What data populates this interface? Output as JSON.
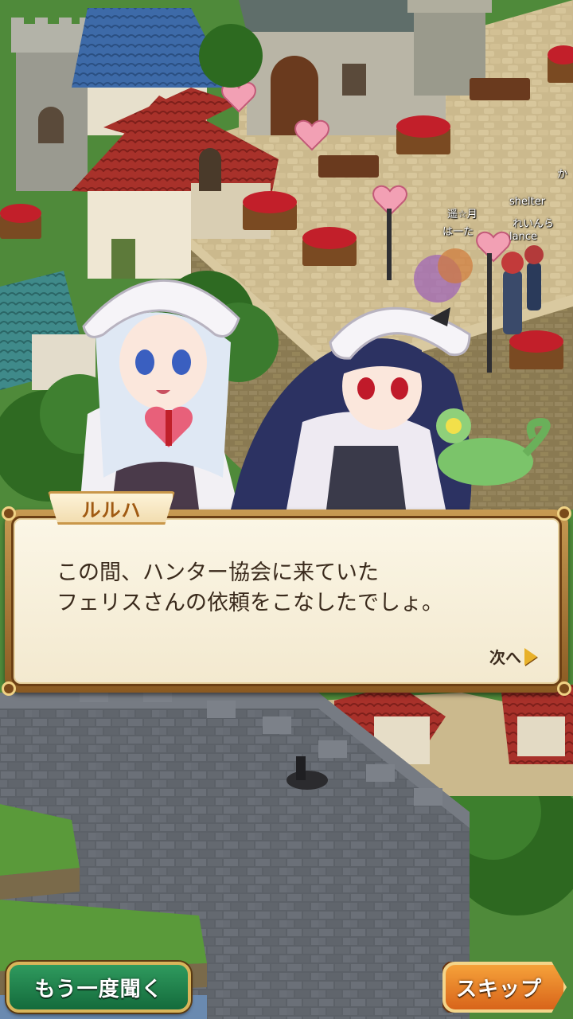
{
  "dialog": {
    "speaker": "ルルハ",
    "text": "この間、ハンター協会に来ていた\nフェリスさんの依頼をこなしたでしょ。",
    "next_label": "次へ"
  },
  "players": [
    {
      "name": "shelter"
    },
    {
      "name": "遥☆月"
    },
    {
      "name": "れいんら"
    },
    {
      "name": "は一た"
    },
    {
      "name": "lance"
    },
    {
      "name": "か"
    }
  ],
  "buttons": {
    "replay_label": "もう一度聞く",
    "skip_label": "スキップ"
  },
  "colors": {
    "dialog_frame": "#a8742f",
    "dialog_bg": "#f8f1dc",
    "replay_button": "#1f7f48",
    "skip_button": "#e8801f"
  }
}
